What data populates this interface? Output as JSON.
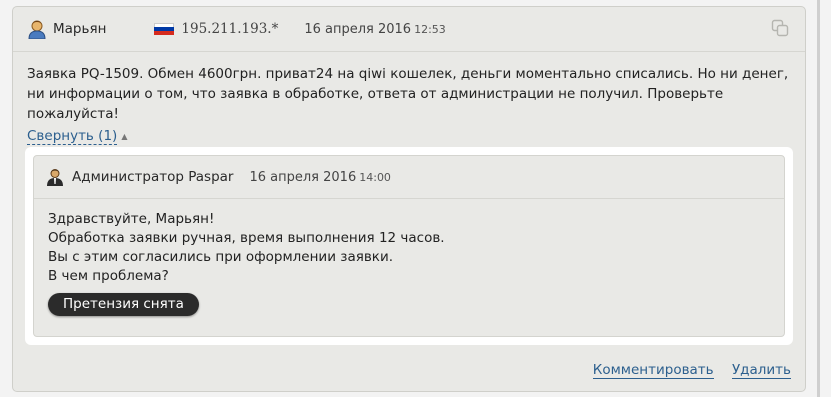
{
  "message": {
    "author": "Марьян",
    "ip": "195.211.193.*",
    "date": "16 апреля 2016",
    "time": "12:53",
    "flag_colors": [
      "#ffffff",
      "#0039a6",
      "#d52b1e"
    ],
    "body": "Заявка PQ-1509. Обмен 4600грн. приват24 на qiwi кошелек, деньги моментально списались. Но ни денег, ни информации о том, что заявка в обработке, ответа от администрации не получил. Проверьте пожалуйста!",
    "collapse_label": "Свернуть (1)"
  },
  "reply": {
    "author": "Администратор Paspar",
    "date": "16 апреля 2016",
    "time": "14:00",
    "lines": [
      "Здравствуйте, Марьян!",
      "Обработка заявки ручная, время выполнения 12 часов.",
      "Вы с этим согласились при оформлении заявки.",
      "В чем проблема?"
    ],
    "status": "Претензия снята"
  },
  "actions": {
    "comment_label": "Комментировать",
    "delete_label": "Удалить"
  },
  "colors": {
    "link": "#2c5f8e",
    "card_bg": "#e9e9e6",
    "badge_bg": "#2b2b2b"
  },
  "icons": {
    "user": "user-icon",
    "admin": "admin-icon",
    "copy": "copy-icon",
    "flag": "russia-flag-icon",
    "collapse": "triangle-up-icon"
  }
}
